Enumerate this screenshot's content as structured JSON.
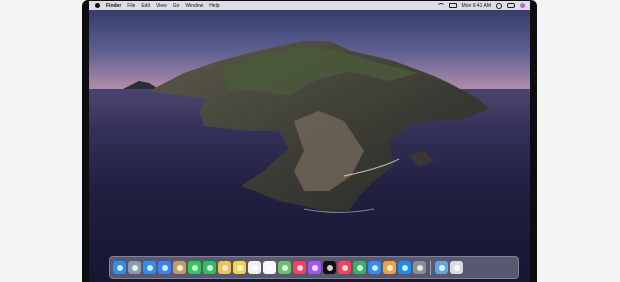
{
  "menubar": {
    "app_name": "Finder",
    "items": [
      "File",
      "Edit",
      "View",
      "Go",
      "Window",
      "Help"
    ],
    "clock": "Mon 9:41 AM"
  },
  "dock": {
    "apps": [
      {
        "name": "finder-icon",
        "color": "#2f8cf0"
      },
      {
        "name": "launchpad-icon",
        "color": "#8a9bb0"
      },
      {
        "name": "safari-icon",
        "color": "#2d8ff5"
      },
      {
        "name": "mail-icon",
        "color": "#3b82f6"
      },
      {
        "name": "contacts-icon",
        "color": "#c89a64"
      },
      {
        "name": "messages-icon",
        "color": "#2ecc55"
      },
      {
        "name": "facetime-icon",
        "color": "#27c45a"
      },
      {
        "name": "photos-icon",
        "color": "#f2c14e"
      },
      {
        "name": "notes-icon",
        "color": "#f5d54a"
      },
      {
        "name": "calendar-icon",
        "color": "#f0f0f0"
      },
      {
        "name": "reminders-icon",
        "color": "#f7f7f7"
      },
      {
        "name": "maps-icon",
        "color": "#6bc06a"
      },
      {
        "name": "music-icon",
        "color": "#fa3f5b"
      },
      {
        "name": "podcasts-icon",
        "color": "#a855f7"
      },
      {
        "name": "tv-icon",
        "color": "#111111"
      },
      {
        "name": "news-icon",
        "color": "#f4435a"
      },
      {
        "name": "numbers-icon",
        "color": "#31b85a"
      },
      {
        "name": "keynote-icon",
        "color": "#2f8cf0"
      },
      {
        "name": "pages-icon",
        "color": "#f3a23a"
      },
      {
        "name": "app-store-icon",
        "color": "#1c8cf5"
      },
      {
        "name": "system-preferences-icon",
        "color": "#8d8d93"
      }
    ],
    "trailing": [
      {
        "name": "downloads-folder-icon",
        "color": "#60a7e8"
      },
      {
        "name": "trash-icon",
        "color": "#d9dde3"
      }
    ]
  }
}
